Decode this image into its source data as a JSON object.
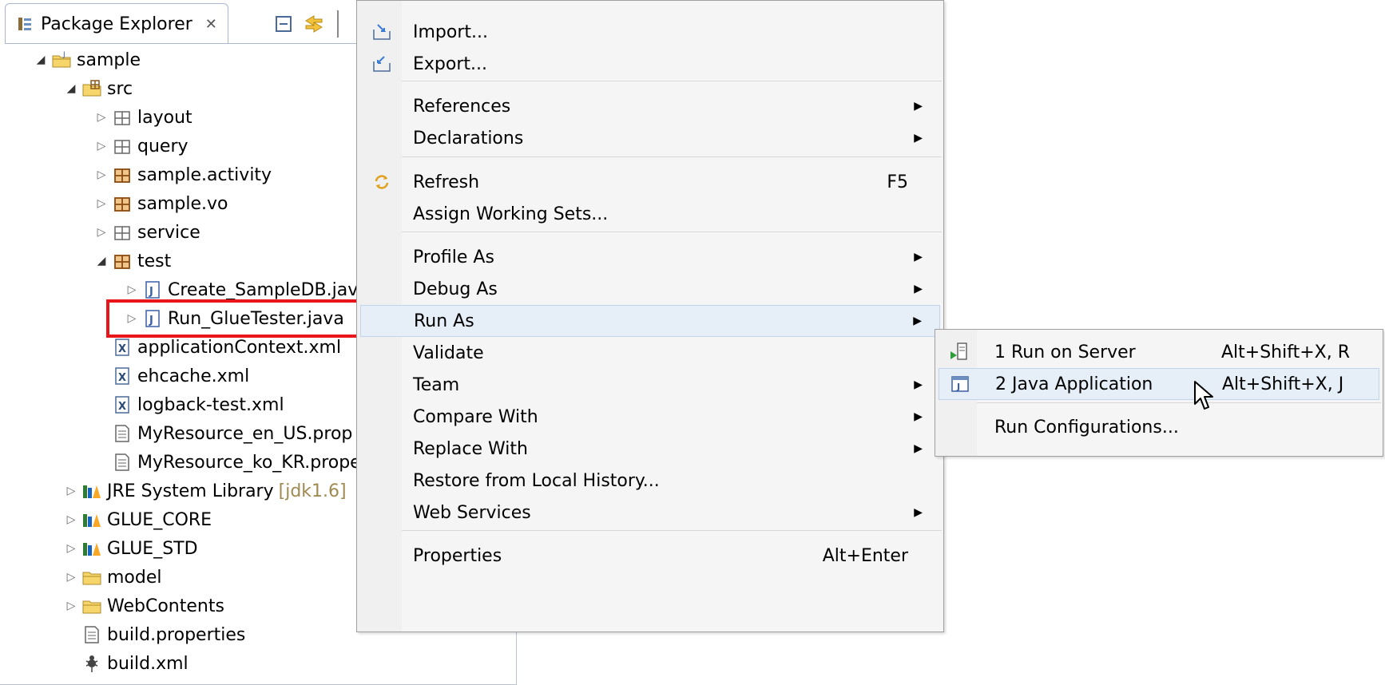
{
  "view": {
    "title": "Package Explorer",
    "close_glyph": "✕"
  },
  "tree": [
    {
      "label": "sample",
      "icon": "java-project-icon",
      "twisty": "open"
    },
    {
      "label": "src",
      "icon": "source-folder-icon",
      "twisty": "open"
    },
    {
      "label": "layout",
      "icon": "empty-package-icon",
      "twisty": "closed"
    },
    {
      "label": "query",
      "icon": "empty-package-icon",
      "twisty": "closed"
    },
    {
      "label": "sample.activity",
      "icon": "package-icon",
      "twisty": "closed"
    },
    {
      "label": "sample.vo",
      "icon": "package-icon",
      "twisty": "closed"
    },
    {
      "label": "service",
      "icon": "empty-package-icon",
      "twisty": "closed"
    },
    {
      "label": "test",
      "icon": "package-icon",
      "twisty": "open"
    },
    {
      "label": "Create_SampleDB.jav",
      "icon": "java-file-icon",
      "twisty": "closed"
    },
    {
      "label": "Run_GlueTester.java",
      "icon": "java-file-icon",
      "twisty": "closed"
    },
    {
      "label": "applicationContext.xml",
      "icon": "xml-file-icon",
      "twisty": "none"
    },
    {
      "label": "ehcache.xml",
      "icon": "xml-file-icon",
      "twisty": "none"
    },
    {
      "label": "logback-test.xml",
      "icon": "xml-file-icon",
      "twisty": "none"
    },
    {
      "label": "MyResource_en_US.prop",
      "icon": "properties-file-icon",
      "twisty": "none"
    },
    {
      "label": "MyResource_ko_KR.prope",
      "icon": "properties-file-icon",
      "twisty": "none"
    },
    {
      "label": "JRE System Library",
      "decoration": "[jdk1.6]",
      "icon": "library-icon",
      "twisty": "closed"
    },
    {
      "label": "GLUE_CORE",
      "icon": "library-icon",
      "twisty": "closed"
    },
    {
      "label": "GLUE_STD",
      "icon": "library-icon",
      "twisty": "closed"
    },
    {
      "label": "model",
      "icon": "folder-icon",
      "twisty": "closed"
    },
    {
      "label": "WebContents",
      "icon": "folder-icon",
      "twisty": "closed"
    },
    {
      "label": "build.properties",
      "icon": "properties-file-icon",
      "twisty": "none"
    },
    {
      "label": "build.xml",
      "icon": "ant-file-icon",
      "twisty": "none"
    }
  ],
  "menu": {
    "items": [
      {
        "label": "Import...",
        "icon": "import-icon"
      },
      {
        "label": "Export...",
        "icon": "export-icon"
      },
      {
        "label": "References",
        "submenu": true
      },
      {
        "label": "Declarations",
        "submenu": true
      },
      {
        "label": "Refresh",
        "shortcut": "F5",
        "icon": "refresh-icon"
      },
      {
        "label": "Assign Working Sets..."
      },
      {
        "label": "Profile As",
        "submenu": true
      },
      {
        "label": "Debug As",
        "submenu": true
      },
      {
        "label": "Run As",
        "submenu": true,
        "active": true
      },
      {
        "label": "Validate"
      },
      {
        "label": "Team",
        "submenu": true
      },
      {
        "label": "Compare With",
        "submenu": true
      },
      {
        "label": "Replace With",
        "submenu": true
      },
      {
        "label": "Restore from Local History..."
      },
      {
        "label": "Web Services",
        "submenu": true
      },
      {
        "label": "Properties",
        "shortcut": "Alt+Enter"
      }
    ]
  },
  "submenu": {
    "items": [
      {
        "label": "1 Run on Server",
        "shortcut": "Alt+Shift+X, R",
        "icon": "run-on-server-icon"
      },
      {
        "label": "2 Java Application",
        "shortcut": "Alt+Shift+X, J",
        "icon": "java-application-icon",
        "active": true
      },
      {
        "label": "Run Configurations..."
      }
    ]
  },
  "colors": {
    "highlight_box": "#e8161b",
    "menu_active_bg": "#e6eef8",
    "decoration_text": "#a08a52"
  }
}
